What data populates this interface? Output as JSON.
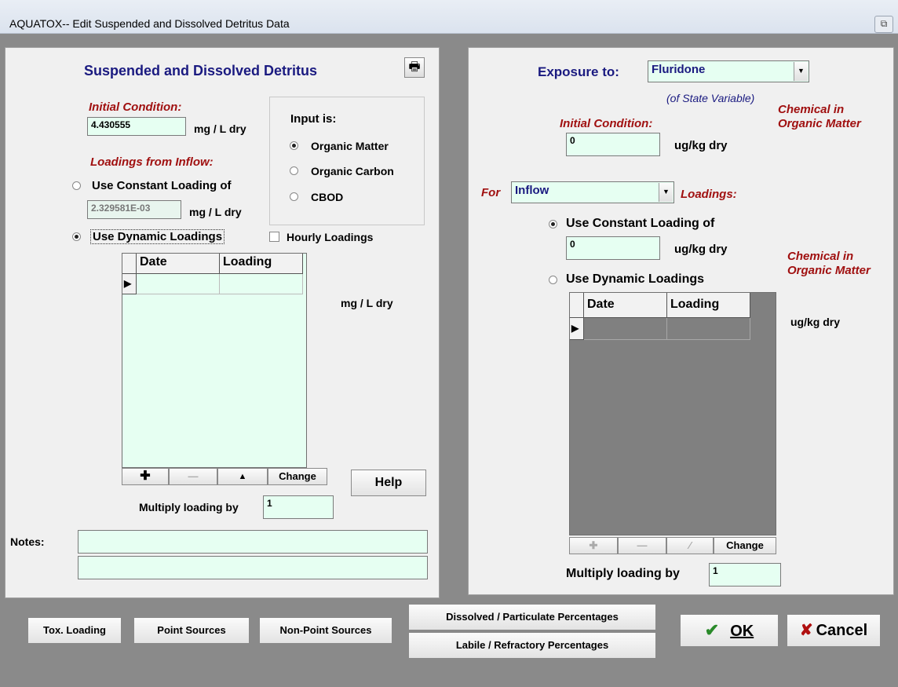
{
  "window": {
    "title": "AQUATOX-- Edit Suspended and Dissolved Detritus Data",
    "system_icon": "restore-icon"
  },
  "left": {
    "heading": "Suspended and Dissolved Detritus",
    "print_icon": "printer-icon",
    "initial_condition_label": "Initial Condition:",
    "initial_condition_value": "4.430555",
    "initial_condition_unit": "mg / L dry",
    "input_is": {
      "label": "Input is:",
      "options": [
        "Organic Matter",
        "Organic Carbon",
        "CBOD"
      ],
      "selected": "Organic Matter"
    },
    "loadings_label": "Loadings from Inflow:",
    "constant_label": "Use Constant Loading of",
    "constant_value": "2.329581E-03",
    "constant_unit": "mg / L dry",
    "dynamic_label": "Use Dynamic Loadings",
    "hourly_label": "Hourly Loadings",
    "grid": {
      "headers": [
        "Date",
        "Loading"
      ]
    },
    "grid_unit": "mg / L dry",
    "nav": {
      "change": "Change"
    },
    "help": "Help",
    "multiply_label": "Multiply loading by",
    "multiply_value": "1",
    "notes_label": "Notes:",
    "notes_1": "",
    "notes_2": ""
  },
  "right": {
    "exposure_label": "Exposure to:",
    "exposure_value": "Fluridone",
    "state_var_note": "(of State Variable)",
    "chem_label_1": "Chemical in Organic Matter",
    "initial_condition_label": "Initial Condition:",
    "initial_condition_value": "0",
    "initial_condition_unit": "ug/kg dry",
    "for_label": "For",
    "for_value": "Inflow",
    "loadings_label": "Loadings:",
    "constant_label": "Use Constant Loading of",
    "constant_value": "0",
    "constant_unit": "ug/kg dry",
    "chem_label_2": "Chemical in Organic Matter",
    "dynamic_label": "Use Dynamic Loadings",
    "grid": {
      "headers": [
        "Date",
        "Loading"
      ]
    },
    "grid_unit": "ug/kg dry",
    "nav": {
      "change": "Change"
    },
    "multiply_label": "Multiply loading by",
    "multiply_value": "1"
  },
  "bottom": {
    "tox_loading": "Tox. Loading",
    "point_sources": "Point Sources",
    "non_point_sources": "Non-Point Sources",
    "dissolved_particulate": "Dissolved / Particulate Percentages",
    "labile_refractory": "Labile / Refractory Percentages",
    "ok": "OK",
    "cancel": "Cancel"
  },
  "colors": {
    "field_bg": "#e6fff2",
    "heading_navy": "#1a1a80",
    "label_red": "#a01010",
    "ok_check": "#2a8a2a",
    "cancel_x": "#b01010"
  }
}
